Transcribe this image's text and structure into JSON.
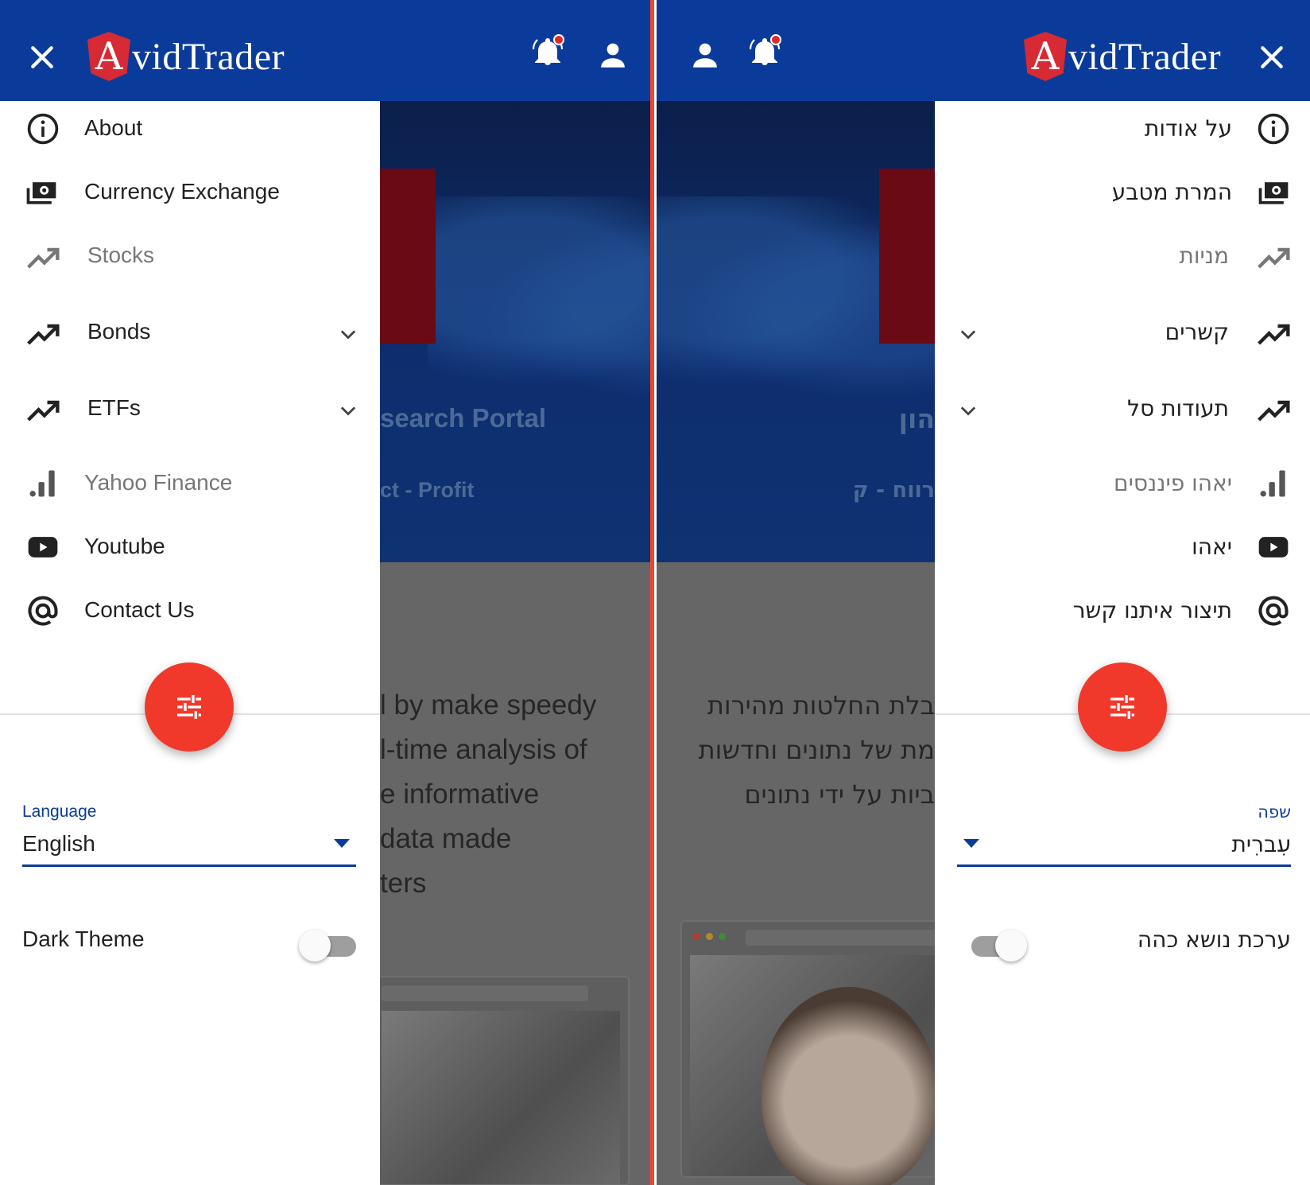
{
  "brand": {
    "logo_letter": "A",
    "logo_rest": "vidTrader"
  },
  "colors": {
    "header": "#0b3b9a",
    "fab": "#f0392b",
    "divider": "#f0452e",
    "logo_shield": "#d62a34"
  },
  "english": {
    "menu": [
      {
        "label": "About",
        "icon": "info-icon"
      },
      {
        "label": "Currency Exchange",
        "icon": "money-icon"
      },
      {
        "label": "Stocks",
        "icon": "trending-up-icon"
      },
      {
        "label": "Bonds",
        "icon": "trending-up-icon",
        "expandable": true
      },
      {
        "label": "ETFs",
        "icon": "trending-up-icon",
        "expandable": true
      },
      {
        "label": "Yahoo Finance",
        "icon": "bar-chart-icon"
      },
      {
        "label": "Youtube",
        "icon": "youtube-icon"
      },
      {
        "label": "Contact Us",
        "icon": "at-sign-icon"
      }
    ],
    "language_label": "Language",
    "language_value": "English",
    "dark_theme_label": "Dark Theme",
    "dark_theme_on": false,
    "background": {
      "heading": "search Portal",
      "subheading": "ct - Profit",
      "paragraph": [
        "l by make speedy",
        "l-time analysis of",
        "e informative",
        "data made",
        "ters"
      ]
    }
  },
  "hebrew": {
    "menu": [
      {
        "label": "על אודות",
        "icon": "info-icon"
      },
      {
        "label": "המרת מטבע",
        "icon": "money-icon"
      },
      {
        "label": "מניות",
        "icon": "trending-up-icon"
      },
      {
        "label": "קשרים",
        "icon": "trending-up-icon",
        "expandable": true
      },
      {
        "label": "תעודות סל",
        "icon": "trending-up-icon",
        "expandable": true
      },
      {
        "label": "יאהו פיננסים",
        "icon": "bar-chart-icon"
      },
      {
        "label": "יאהו",
        "icon": "youtube-icon"
      },
      {
        "label": "תיצור איתנו קשר",
        "icon": "at-sign-icon"
      }
    ],
    "language_label": "שפה",
    "language_value": "עִברִית",
    "dark_theme_label": "ערכת נושא כהה",
    "dark_theme_on": false,
    "background": {
      "heading": "הון",
      "subheading": "רווח - ק",
      "paragraph": [
        "בלת החלטות מהירות",
        "מת של נתונים וחדשות",
        "ביות על ידי נתונים"
      ]
    }
  }
}
